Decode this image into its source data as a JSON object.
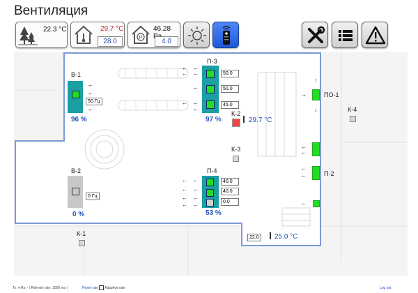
{
  "title": "Вентиляция",
  "tiles": {
    "outdoor_temp": "22.3 °C",
    "indoor_temp": "29.7 °C",
    "indoor_setpoint": "28.0",
    "pressure": "46.28 Pa",
    "pressure_setpoint": "4.0"
  },
  "units": {
    "v1": {
      "label": "В-1",
      "pct": "96 %",
      "hz": "50 Гц"
    },
    "v2": {
      "label": "В-2",
      "pct": "0 %",
      "hz": "0 Гц"
    },
    "p3": {
      "label": "П-3",
      "pct": "97 %",
      "vals": [
        "50.0",
        "50.0",
        "45.0"
      ]
    },
    "p4": {
      "label": "П-4",
      "pct": "53 %",
      "vals": [
        "40.0",
        "40.0",
        "0.0"
      ]
    },
    "po1": {
      "label": "ПО-1"
    },
    "p2": {
      "label": "П-2"
    },
    "k1": {
      "label": "К-1"
    },
    "k2": {
      "label": "К-2",
      "temp": "29.7 °C"
    },
    "k3": {
      "label": "К-3"
    },
    "k4": {
      "label": "К-4"
    },
    "bottom": {
      "setpoint": "22.0",
      "temp": "25.0 °C"
    }
  },
  "footer": {
    "left": "Тх: ▾  Rx: - | Refresh rate: 1000 ms |",
    "reset": "Reset rate",
    "adaptive": "Adaptive rate",
    "logout": "Log out"
  },
  "colors": {
    "teal": "#1a9fa3",
    "green": "#22dd22",
    "red": "#ee4444",
    "wall": "#7a9ad8",
    "text_blue": "#1f4fbf",
    "alarm_red": "#c0262a",
    "setpoint_blue": "#2a4fb0"
  },
  "icons": [
    "tree-icon",
    "house-thermometer-icon",
    "house-pressure-icon",
    "sun-icon",
    "remote-icon",
    "tools-icon",
    "list-icon",
    "warning-icon"
  ]
}
